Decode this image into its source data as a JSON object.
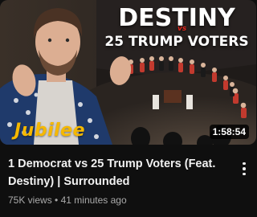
{
  "video": {
    "thumbnail": {
      "headline_top": "DESTINY",
      "headline_vs": "vs",
      "headline_bottom_prefix": "25 ",
      "headline_bottom_trump": "TRUMP",
      "headline_bottom_suffix": " VOTERS",
      "channel_logo": "Jubilee",
      "duration": "1:58:54"
    },
    "title": "1 Democrat vs 25 Trump Voters (Feat. Destiny) | Surrounded",
    "views": "75K views",
    "separator": "•",
    "age": "41 minutes ago",
    "menu_icon": "more-vertical-icon"
  },
  "colors": {
    "background": "#0f0f0f",
    "title_text": "#f1f1f1",
    "meta_text": "#aaaaaa",
    "vs_red": "#e2261d",
    "logo_yellow": "#f5b800"
  }
}
